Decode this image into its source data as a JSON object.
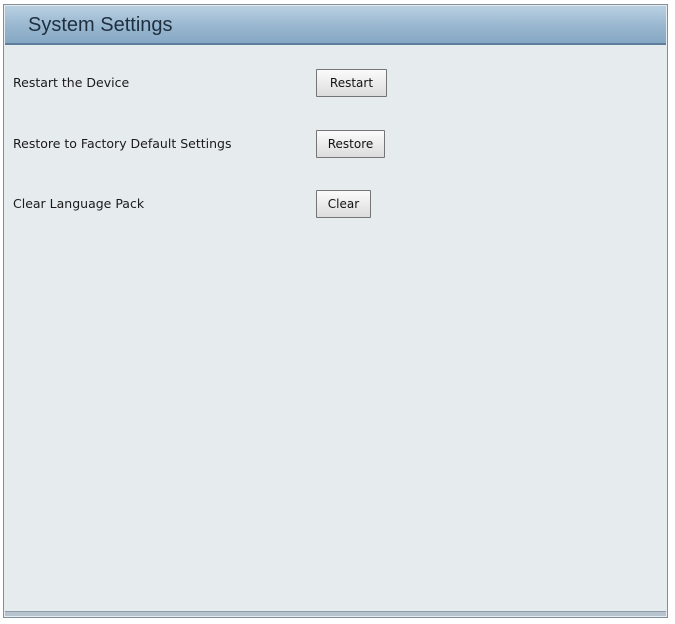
{
  "header": {
    "title": "System Settings"
  },
  "rows": [
    {
      "label": "Restart the Device",
      "button_label": "Restart"
    },
    {
      "label": "Restore to Factory Default Settings",
      "button_label": "Restore"
    },
    {
      "label": "Clear Language Pack",
      "button_label": "Clear"
    }
  ],
  "colors": {
    "header_gradient_top": "#b9d0e2",
    "header_gradient_bottom": "#86a8c5",
    "panel_background": "#e6ebee",
    "frame_border": "#7f8f9c"
  }
}
